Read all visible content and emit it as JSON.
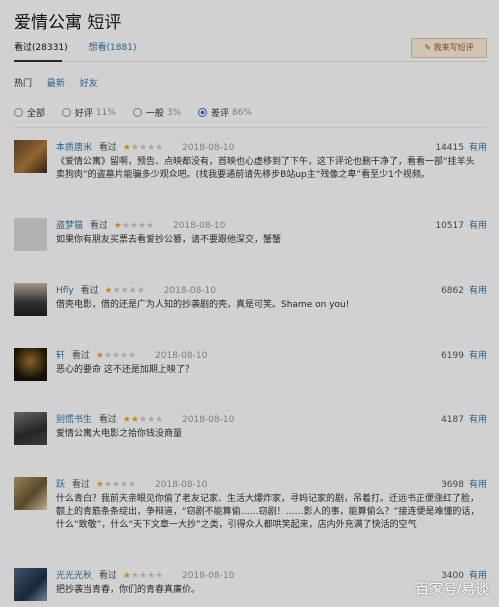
{
  "header": {
    "title": "爱情公寓",
    "subtitle": "短评"
  },
  "tabs": [
    {
      "label": "看过(28331)"
    },
    {
      "label": "想看(1881)"
    }
  ],
  "write_button": {
    "label": "我来写短评",
    "icon": "pencil-icon"
  },
  "sort": [
    "热门",
    "最新",
    "好友"
  ],
  "filters": [
    {
      "label": "全部",
      "pct": ""
    },
    {
      "label": "好评",
      "pct": "11%"
    },
    {
      "label": "一般",
      "pct": "3%"
    },
    {
      "label": "差评",
      "pct": "86%"
    }
  ],
  "reviews": [
    {
      "user": "本质唐米",
      "label": "看过",
      "rating": 1,
      "date": "2018-08-10",
      "votes": "14415",
      "useful": "有用",
      "text": "《爱情公寓》留啊，预告、点映都没有，首映也心虚移到了下午，这下评论也删干净了，看看一部“挂羊头卖狗肉”的盗墓片能骗多少观众吧。(找我要通前请先移步B站up主“残像之卑”看至少1个视频。"
    },
    {
      "user": "盗梦猫",
      "label": "看过",
      "rating": 1,
      "date": "2018-08-10",
      "votes": "10517",
      "useful": "有用",
      "text": "如果你有朋友买票去看爱抄公篡，请不要跟他深交，蟹蟹"
    },
    {
      "user": "Hfly",
      "label": "看过",
      "rating": 1,
      "date": "2018-08-10",
      "votes": "6862",
      "useful": "有用",
      "text": "借壳电影，借的还是广为人知的抄袭剧的壳，真是可笑。Shame on you!"
    },
    {
      "user": "轩",
      "label": "看过",
      "rating": 1,
      "date": "2018-08-10",
      "votes": "6199",
      "useful": "有用",
      "text": "恶心的要命 这不还是加期上映了？"
    },
    {
      "user": "别慌书生",
      "label": "看过",
      "rating": 2,
      "date": "2018-08-10",
      "votes": "4187",
      "useful": "有用",
      "text": "爱情公寓大电影之拾你钱没商量"
    },
    {
      "user": "跃",
      "label": "看过",
      "rating": 1,
      "date": "2018-08-10",
      "votes": "3698",
      "useful": "有用",
      "text": "什么青白？我前天亲眼见你偷了老友记家、生活大爆炸家，寻妈记家的剧，吊着打。迁远书正便涨红了脸，额上的青筋条条绽出，争辩道，“窃剧不能算偷……窃剧！……影人的事，能算偷么？”接连便是难懂的话，什么“致敬”，什么“天下文章一大抄”之类，引得众人都哄笑起来，店内外充满了快活的空气"
    },
    {
      "user": "光光光秋",
      "label": "看过",
      "rating": 1,
      "date": "2018-08-10",
      "votes": "3400",
      "useful": "有用",
      "text": "把抄袭当青春，你们的青春真廉价。"
    }
  ],
  "watermark": "百家号/易谈"
}
